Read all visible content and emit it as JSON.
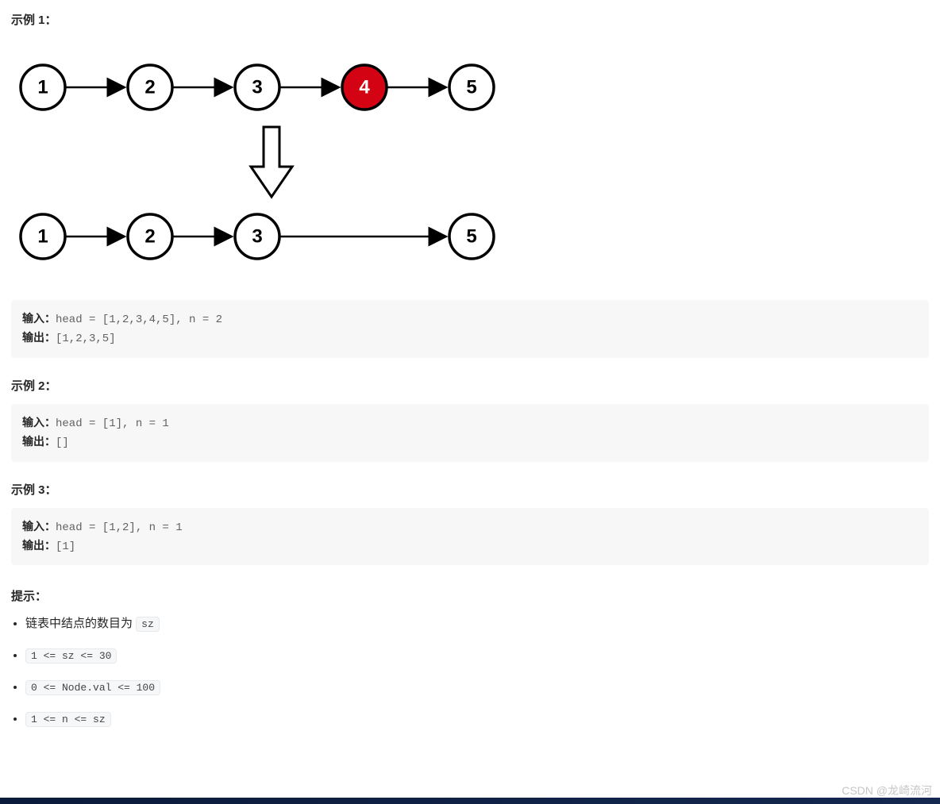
{
  "example1": {
    "title": "示例 1：",
    "diagram": {
      "row1": [
        {
          "v": "1",
          "fill": "#fff",
          "color": "#000"
        },
        {
          "v": "2",
          "fill": "#fff",
          "color": "#000"
        },
        {
          "v": "3",
          "fill": "#fff",
          "color": "#000"
        },
        {
          "v": "4",
          "fill": "#d30313",
          "color": "#fff"
        },
        {
          "v": "5",
          "fill": "#fff",
          "color": "#000"
        }
      ],
      "row2": [
        {
          "v": "1",
          "fill": "#fff",
          "color": "#000"
        },
        {
          "v": "2",
          "fill": "#fff",
          "color": "#000"
        },
        {
          "v": "3",
          "fill": "#fff",
          "color": "#000"
        },
        {
          "v": "5",
          "fill": "#fff",
          "color": "#000",
          "skipGap": true
        }
      ]
    },
    "input_label": "输入：",
    "input_value": "head = [1,2,3,4,5], n = 2",
    "output_label": "输出：",
    "output_value": "[1,2,3,5]"
  },
  "example2": {
    "title": "示例 2：",
    "input_label": "输入：",
    "input_value": "head = [1], n = 1",
    "output_label": "输出：",
    "output_value": "[]"
  },
  "example3": {
    "title": "示例 3：",
    "input_label": "输入：",
    "input_value": "head = [1,2], n = 1",
    "output_label": "输出：",
    "output_value": "[1]"
  },
  "hints": {
    "title": "提示：",
    "items": [
      {
        "prefix": "链表中结点的数目为 ",
        "code": "sz"
      },
      {
        "prefix": "",
        "code": "1 <= sz <= 30"
      },
      {
        "prefix": "",
        "code": "0 <= Node.val <= 100"
      },
      {
        "prefix": "",
        "code": "1 <= n <= sz"
      }
    ]
  },
  "watermark": "CSDN @龙崎流河"
}
